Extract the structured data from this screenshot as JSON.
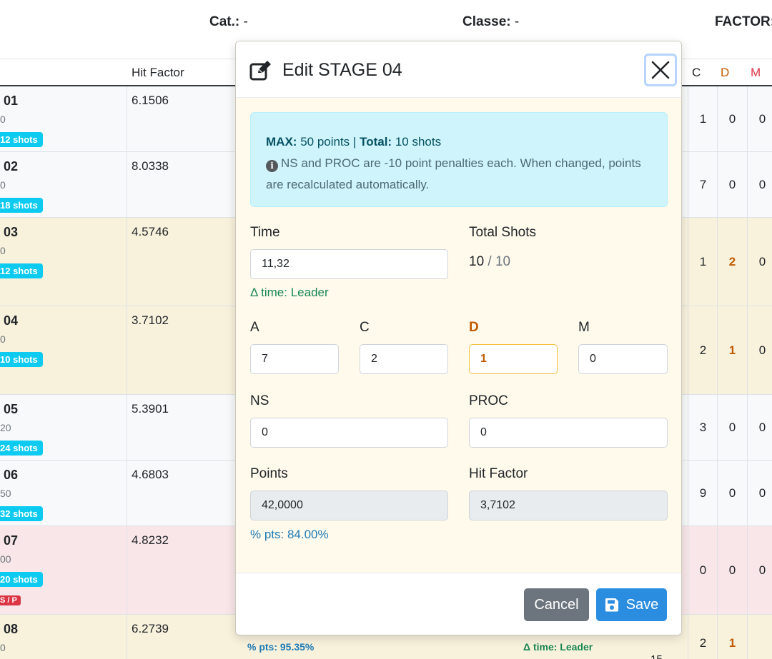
{
  "header": {
    "cat_label": "Cat.:",
    "cat_value": "-",
    "class_label": "Classe:",
    "class_value": "-",
    "factor_label": "FACTOR:"
  },
  "table": {
    "col_hit_factor": "Hit Factor",
    "col_c": "C",
    "col_d": "D",
    "col_m": "M",
    "rows": [
      {
        "stage": "01",
        "time": "0",
        "shots": "12 shots",
        "hf": "6.1506",
        "c": "1",
        "d": "0",
        "m": "0",
        "dq": ""
      },
      {
        "stage": "02",
        "time": "0",
        "shots": "18 shots",
        "hf": "8.0338",
        "c": "7",
        "d": "0",
        "m": "0",
        "dq": ""
      },
      {
        "stage": "03",
        "time": "0",
        "shots": "12 shots",
        "hf": "4.5746",
        "c": "1",
        "d": "2",
        "m": "0",
        "dq": ""
      },
      {
        "stage": "04",
        "time": "0",
        "shots": "10 shots",
        "hf": "3.7102",
        "c": "2",
        "d": "1",
        "m": "0",
        "dq": ""
      },
      {
        "stage": "05",
        "time": "20",
        "shots": "24 shots",
        "hf": "5.3901",
        "c": "3",
        "d": "0",
        "m": "0",
        "dq": ""
      },
      {
        "stage": "06",
        "time": "50",
        "shots": "32 shots",
        "hf": "4.6803",
        "c": "9",
        "d": "0",
        "m": "0",
        "dq": ""
      },
      {
        "stage": "07",
        "time": "00",
        "shots": "20 shots",
        "hf": "4.8232",
        "c": "0",
        "d": "0",
        "m": "0",
        "dq": "S / P"
      },
      {
        "stage": "08",
        "time": "0",
        "shots": "",
        "hf": "6.2739",
        "c": "2",
        "d": "1",
        "m": "",
        "dq": ""
      }
    ],
    "row8_pts": "% pts: 95.35%",
    "row8_time": "Δ time: Leader",
    "row8_partial": "15"
  },
  "modal": {
    "title": "Edit STAGE 04",
    "alert": {
      "max_label": "MAX:",
      "max_value": "50 points",
      "sep": "|",
      "total_label": "Total:",
      "total_value": "10 shots",
      "info": "NS and PROC are -10 point penalties each. When changed, points are recalculated automatically.",
      "info_glyph": "i"
    },
    "time_label": "Time",
    "time_value": "11,32",
    "time_hint": "Δ time: Leader",
    "total_shots_label": "Total Shots",
    "total_shots_current": "10",
    "total_shots_sep": "/",
    "total_shots_max": "10",
    "a_label": "A",
    "a_value": "7",
    "c_label": "C",
    "c_value": "2",
    "d_label": "D",
    "d_value": "1",
    "m_label": "M",
    "m_value": "0",
    "ns_label": "NS",
    "ns_value": "0",
    "proc_label": "PROC",
    "proc_value": "0",
    "points_label": "Points",
    "points_value": "42,0000",
    "points_hint": "% pts: 84.00%",
    "hf_label": "Hit Factor",
    "hf_value": "3,7102",
    "cancel_label": "Cancel",
    "save_label": "Save"
  },
  "colors": {
    "row_white": "#f8f9fa",
    "row_yellow": "#f8f2dc",
    "row_red": "#f8e6e8",
    "d_highlight": "#c05a00",
    "badge_cyan": "#0dcaf0"
  }
}
